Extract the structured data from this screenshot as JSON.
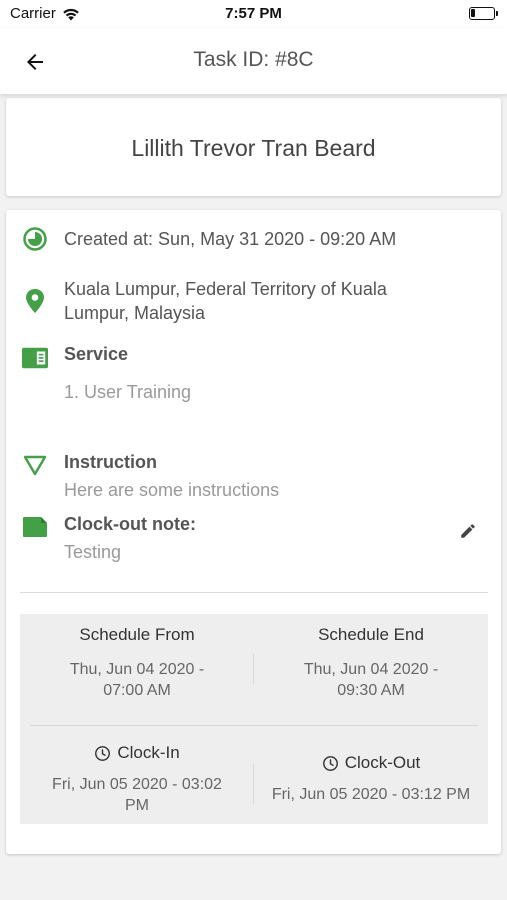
{
  "status_bar": {
    "carrier": "Carrier",
    "time": "7:57 PM"
  },
  "header": {
    "title": "Task ID: #8C"
  },
  "customer": {
    "name": "Lillith Trevor Tran Beard"
  },
  "details": {
    "created": "Created at: Sun, May 31 2020 - 09:20 AM",
    "address_line1": "Kuala Lumpur, Federal Territory of Kuala",
    "address_line2": "Lumpur, Malaysia",
    "service_label": "Service",
    "service_item": "1. User Training",
    "instruction_label": "Instruction",
    "instruction_text": "Here are some instructions",
    "clockout_note_label": "Clock-out note:",
    "clockout_note_text": "Testing"
  },
  "schedule": {
    "from_label": "Schedule From",
    "from_line1": "Thu, Jun 04 2020 -",
    "from_line2": "07:00 AM",
    "end_label": "Schedule End",
    "end_line1": "Thu, Jun 04 2020 -",
    "end_line2": "09:30 AM",
    "clockin_label": "Clock-In",
    "clockin_line1": "Fri, Jun 05 2020 - 03:02",
    "clockin_line2": "PM",
    "clockout_label": "Clock-Out",
    "clockout_value": "Fri, Jun 05 2020 - 03:12 PM"
  },
  "colors": {
    "accent_green": "#43a047",
    "background": "#f2f2f2"
  },
  "icons": [
    "wifi-icon",
    "battery-icon",
    "back-arrow-icon",
    "clock-icon",
    "location-pin-icon",
    "service-card-icon",
    "instruction-triangle-icon",
    "note-icon",
    "edit-pencil-icon"
  ]
}
